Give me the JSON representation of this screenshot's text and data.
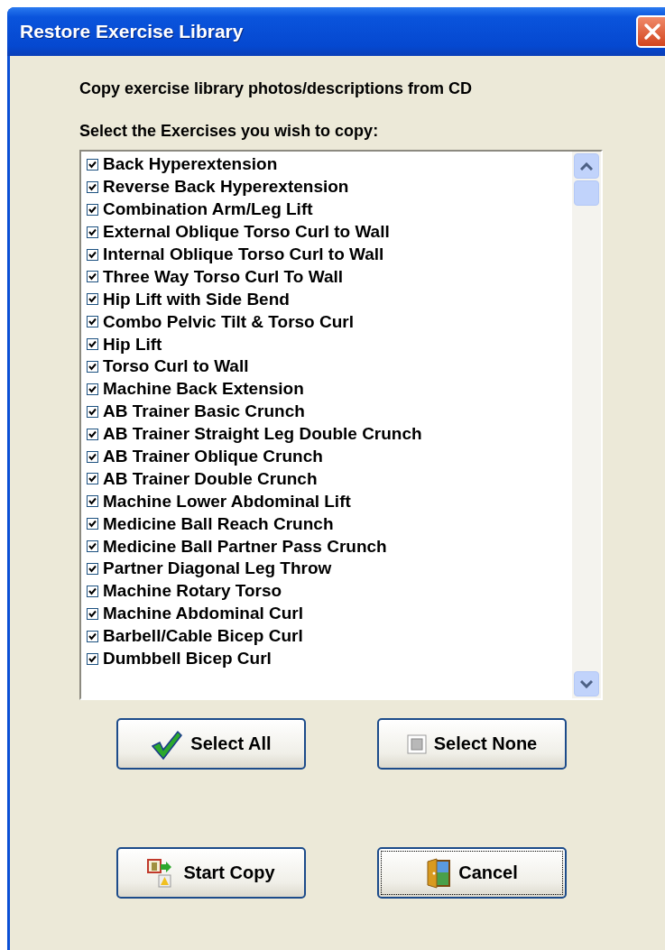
{
  "window": {
    "title": "Restore Exercise Library"
  },
  "instruction": "Copy exercise library photos/descriptions from CD",
  "list_label": "Select the Exercises you wish to copy:",
  "exercises": [
    {
      "label": "Back Hyperextension",
      "checked": true
    },
    {
      "label": "Reverse Back Hyperextension",
      "checked": true
    },
    {
      "label": "Combination Arm/Leg Lift",
      "checked": true
    },
    {
      "label": "External Oblique Torso Curl to Wall",
      "checked": true
    },
    {
      "label": "Internal Oblique Torso Curl to Wall",
      "checked": true
    },
    {
      "label": "Three Way Torso Curl To Wall",
      "checked": true
    },
    {
      "label": "Hip Lift with Side Bend",
      "checked": true
    },
    {
      "label": "Combo Pelvic Tilt & Torso Curl",
      "checked": true
    },
    {
      "label": "Hip Lift",
      "checked": true
    },
    {
      "label": "Torso Curl to Wall",
      "checked": true
    },
    {
      "label": "Machine Back Extension",
      "checked": true
    },
    {
      "label": "AB Trainer Basic Crunch",
      "checked": true
    },
    {
      "label": "AB Trainer Straight Leg Double Crunch",
      "checked": true
    },
    {
      "label": "AB Trainer Oblique Crunch",
      "checked": true
    },
    {
      "label": "AB Trainer Double Crunch",
      "checked": true
    },
    {
      "label": "Machine Lower Abdominal Lift",
      "checked": true
    },
    {
      "label": "Medicine Ball Reach Crunch",
      "checked": true
    },
    {
      "label": "Medicine Ball Partner Pass Crunch",
      "checked": true
    },
    {
      "label": "Partner Diagonal Leg Throw",
      "checked": true
    },
    {
      "label": "Machine Rotary Torso",
      "checked": true
    },
    {
      "label": "Machine Abdominal Curl",
      "checked": true
    },
    {
      "label": "Barbell/Cable Bicep Curl",
      "checked": true
    },
    {
      "label": "Dumbbell Bicep Curl",
      "checked": true
    }
  ],
  "buttons": [
    {
      "label": "Select All",
      "kind": "check",
      "focused": false
    },
    {
      "label": "Select None",
      "kind": "box",
      "focused": false
    },
    {
      "label": "Start Copy",
      "kind": "copy",
      "focused": false
    },
    {
      "label": "Cancel",
      "kind": "door",
      "focused": true
    }
  ]
}
